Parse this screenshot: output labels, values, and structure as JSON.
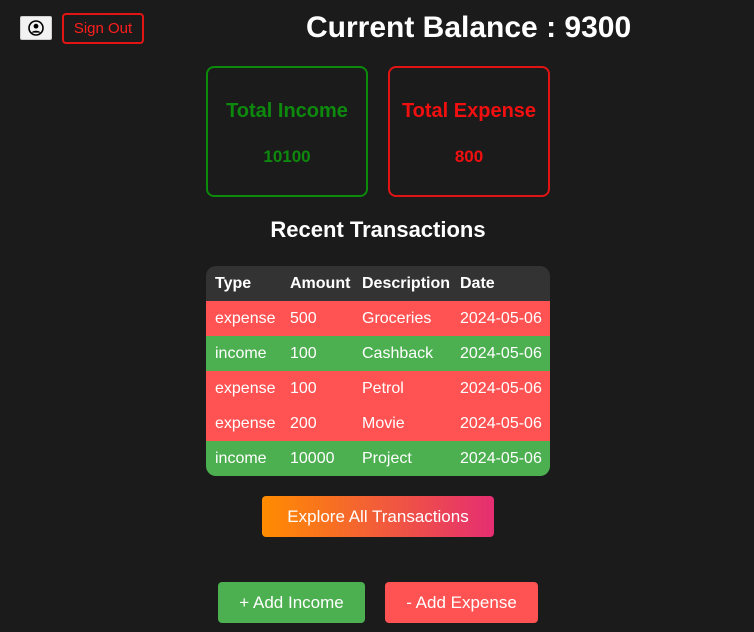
{
  "header": {
    "profile_icon": "user-circle-icon",
    "sign_out_label": "Sign Out",
    "balance_label": "Current Balance : 9300"
  },
  "summary": {
    "income": {
      "title": "Total Income",
      "value": "10100",
      "color": "#0d8a0d"
    },
    "expense": {
      "title": "Total Expense",
      "value": "800",
      "color": "#f20f0f"
    }
  },
  "transactions": {
    "title": "Recent Transactions",
    "columns": [
      "Type",
      "Amount",
      "Description",
      "Date"
    ],
    "rows": [
      {
        "type": "expense",
        "amount": "500",
        "description": "Groceries",
        "date": "2024-05-06"
      },
      {
        "type": "income",
        "amount": "100",
        "description": "Cashback",
        "date": "2024-05-06"
      },
      {
        "type": "expense",
        "amount": "100",
        "description": "Petrol",
        "date": "2024-05-06"
      },
      {
        "type": "expense",
        "amount": "200",
        "description": "Movie",
        "date": "2024-05-06"
      },
      {
        "type": "income",
        "amount": "10000",
        "description": "Project",
        "date": "2024-05-06"
      }
    ],
    "row_colors": {
      "expense": "#ff5252",
      "income": "#4caf50"
    }
  },
  "actions": {
    "explore_label": "Explore All Transactions",
    "add_income_label": "+ Add Income",
    "add_expense_label": "- Add Expense"
  },
  "colors": {
    "background": "#1b1b1b",
    "accent_gradient_start": "#ff8c00",
    "accent_gradient_end": "#e52e71",
    "income": "#4caf50",
    "expense": "#ff5252"
  }
}
